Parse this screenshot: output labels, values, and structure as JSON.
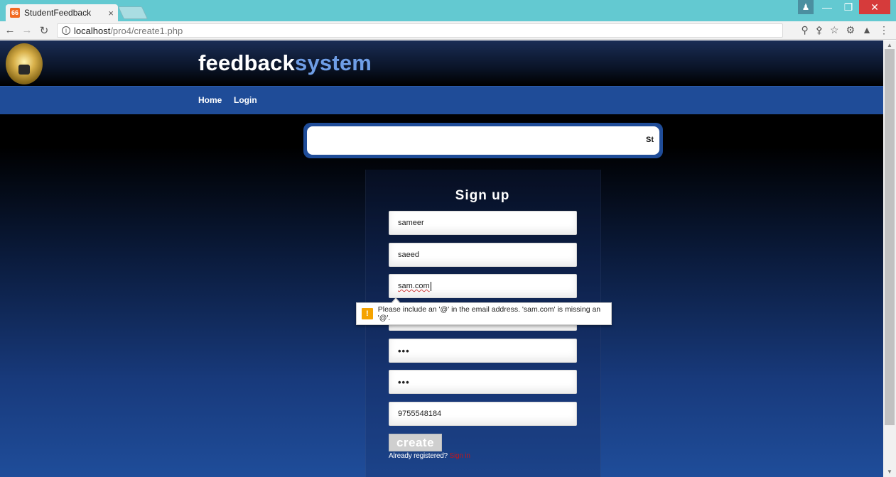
{
  "browser": {
    "tab_title": "StudentFeedback",
    "tab_close": "×",
    "favicon_text": "66",
    "url_host": "localhost",
    "url_path": "/pro4/create1.php",
    "icons": [
      "back-icon",
      "forward-icon",
      "reload-icon",
      "info-icon",
      "zoom-icon",
      "key-icon",
      "star-icon",
      "extension-icon",
      "incognito-icon",
      "menu-icon"
    ]
  },
  "site": {
    "brand_part1": "feedback",
    "brand_part2": "system",
    "nav": {
      "home": "Home",
      "login": "Login"
    },
    "search_text": "St"
  },
  "form": {
    "title": "Sign up",
    "fields": {
      "first_name": "sameer",
      "last_name": "saeed",
      "email": "sam.com",
      "password": "•••",
      "confirm_password": "•••",
      "phone": "9755548184"
    },
    "validation_message": "Please include an '@' in the email address. 'sam.com' is missing an '@'.",
    "create_label": "create",
    "already_registered": "Already registered?",
    "signin_link": "Sign in"
  },
  "colors": {
    "titlebar": "#63c9d1",
    "navbar": "#1f4c98",
    "brand_accent": "#6f9ee6",
    "warning": "#f5a300",
    "link": "#c0151b"
  }
}
